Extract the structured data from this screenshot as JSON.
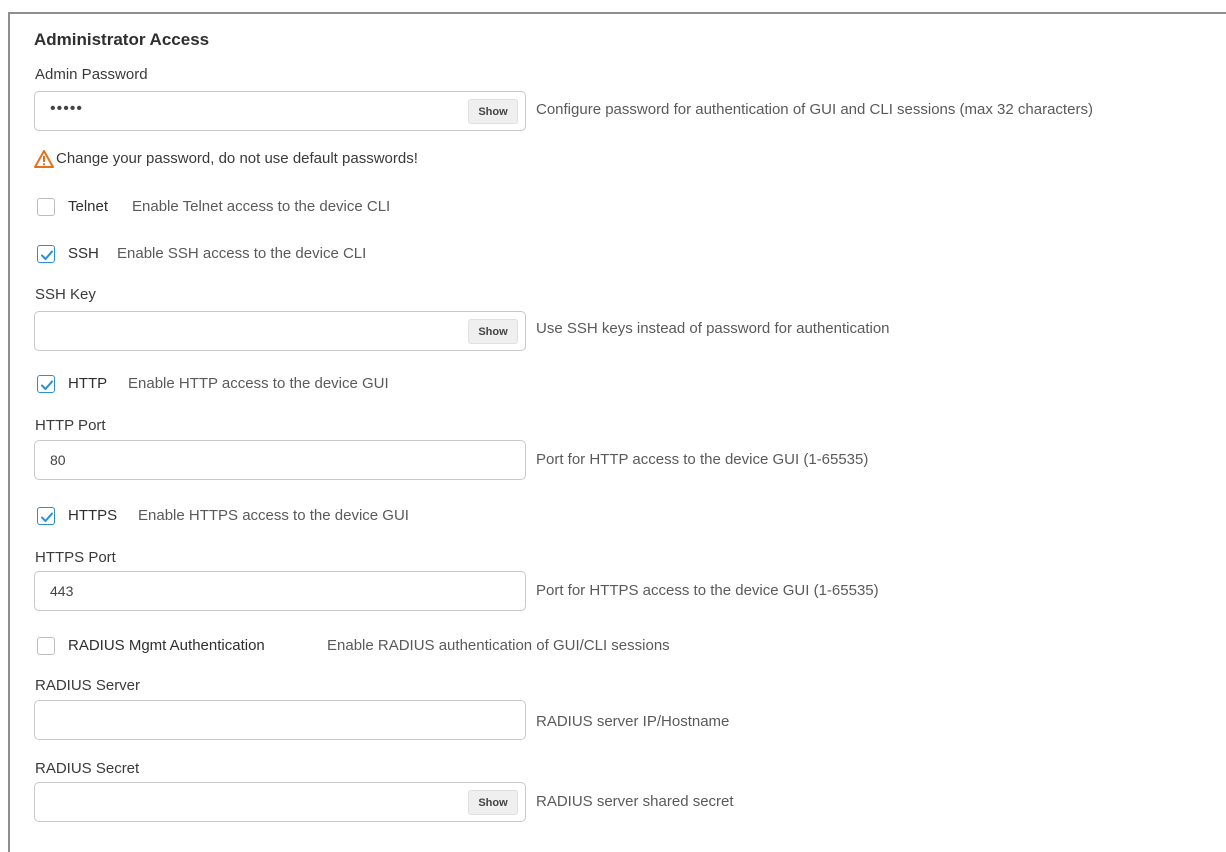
{
  "section_title": "Administrator Access",
  "admin_password": {
    "label": "Admin Password",
    "value": "•••••",
    "show_label": "Show",
    "help": "Configure password for authentication of GUI and CLI sessions (max 32 characters)"
  },
  "warning": {
    "icon": "warning-triangle-icon",
    "text": "Change your password, do not use default passwords!",
    "color": "#e8701a"
  },
  "telnet": {
    "title": "Telnet",
    "desc": "Enable Telnet access to the device CLI",
    "checked": false
  },
  "ssh": {
    "title": "SSH",
    "desc": "Enable SSH access to the device CLI",
    "checked": true
  },
  "ssh_key": {
    "label": "SSH Key",
    "value": "",
    "show_label": "Show",
    "help": "Use SSH keys instead of password for authentication"
  },
  "http": {
    "title": "HTTP",
    "desc": "Enable HTTP access to the device GUI",
    "checked": true
  },
  "http_port": {
    "label": "HTTP Port",
    "value": "80",
    "help": "Port for HTTP access to the device GUI (1-65535)"
  },
  "https": {
    "title": "HTTPS",
    "desc": "Enable HTTPS access to the device GUI",
    "checked": true
  },
  "https_port": {
    "label": "HTTPS Port",
    "value": "443",
    "help": "Port for HTTPS access to the device GUI (1-65535)"
  },
  "radius_auth": {
    "title": "RADIUS Mgmt Authentication",
    "desc": "Enable RADIUS authentication of GUI/CLI sessions",
    "checked": false
  },
  "radius_server": {
    "label": "RADIUS Server",
    "value": "",
    "help": "RADIUS server IP/Hostname"
  },
  "radius_secret": {
    "label": "RADIUS Secret",
    "value": "",
    "show_label": "Show",
    "help": "RADIUS server shared secret"
  },
  "colors": {
    "accent": "#2a8fd6",
    "warning": "#e8701a"
  }
}
